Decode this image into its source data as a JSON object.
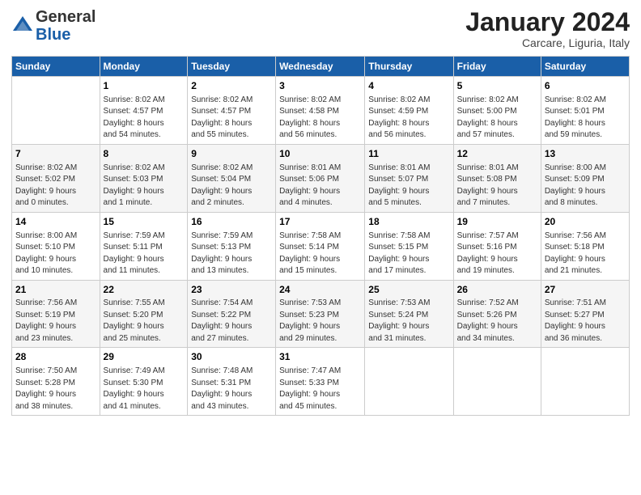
{
  "header": {
    "logo_general": "General",
    "logo_blue": "Blue",
    "month_title": "January 2024",
    "subtitle": "Carcare, Liguria, Italy"
  },
  "columns": [
    "Sunday",
    "Monday",
    "Tuesday",
    "Wednesday",
    "Thursday",
    "Friday",
    "Saturday"
  ],
  "weeks": [
    [
      {
        "day": "",
        "info": ""
      },
      {
        "day": "1",
        "info": "Sunrise: 8:02 AM\nSunset: 4:57 PM\nDaylight: 8 hours\nand 54 minutes."
      },
      {
        "day": "2",
        "info": "Sunrise: 8:02 AM\nSunset: 4:57 PM\nDaylight: 8 hours\nand 55 minutes."
      },
      {
        "day": "3",
        "info": "Sunrise: 8:02 AM\nSunset: 4:58 PM\nDaylight: 8 hours\nand 56 minutes."
      },
      {
        "day": "4",
        "info": "Sunrise: 8:02 AM\nSunset: 4:59 PM\nDaylight: 8 hours\nand 56 minutes."
      },
      {
        "day": "5",
        "info": "Sunrise: 8:02 AM\nSunset: 5:00 PM\nDaylight: 8 hours\nand 57 minutes."
      },
      {
        "day": "6",
        "info": "Sunrise: 8:02 AM\nSunset: 5:01 PM\nDaylight: 8 hours\nand 59 minutes."
      }
    ],
    [
      {
        "day": "7",
        "info": "Sunrise: 8:02 AM\nSunset: 5:02 PM\nDaylight: 9 hours\nand 0 minutes."
      },
      {
        "day": "8",
        "info": "Sunrise: 8:02 AM\nSunset: 5:03 PM\nDaylight: 9 hours\nand 1 minute."
      },
      {
        "day": "9",
        "info": "Sunrise: 8:02 AM\nSunset: 5:04 PM\nDaylight: 9 hours\nand 2 minutes."
      },
      {
        "day": "10",
        "info": "Sunrise: 8:01 AM\nSunset: 5:06 PM\nDaylight: 9 hours\nand 4 minutes."
      },
      {
        "day": "11",
        "info": "Sunrise: 8:01 AM\nSunset: 5:07 PM\nDaylight: 9 hours\nand 5 minutes."
      },
      {
        "day": "12",
        "info": "Sunrise: 8:01 AM\nSunset: 5:08 PM\nDaylight: 9 hours\nand 7 minutes."
      },
      {
        "day": "13",
        "info": "Sunrise: 8:00 AM\nSunset: 5:09 PM\nDaylight: 9 hours\nand 8 minutes."
      }
    ],
    [
      {
        "day": "14",
        "info": "Sunrise: 8:00 AM\nSunset: 5:10 PM\nDaylight: 9 hours\nand 10 minutes."
      },
      {
        "day": "15",
        "info": "Sunrise: 7:59 AM\nSunset: 5:11 PM\nDaylight: 9 hours\nand 11 minutes."
      },
      {
        "day": "16",
        "info": "Sunrise: 7:59 AM\nSunset: 5:13 PM\nDaylight: 9 hours\nand 13 minutes."
      },
      {
        "day": "17",
        "info": "Sunrise: 7:58 AM\nSunset: 5:14 PM\nDaylight: 9 hours\nand 15 minutes."
      },
      {
        "day": "18",
        "info": "Sunrise: 7:58 AM\nSunset: 5:15 PM\nDaylight: 9 hours\nand 17 minutes."
      },
      {
        "day": "19",
        "info": "Sunrise: 7:57 AM\nSunset: 5:16 PM\nDaylight: 9 hours\nand 19 minutes."
      },
      {
        "day": "20",
        "info": "Sunrise: 7:56 AM\nSunset: 5:18 PM\nDaylight: 9 hours\nand 21 minutes."
      }
    ],
    [
      {
        "day": "21",
        "info": "Sunrise: 7:56 AM\nSunset: 5:19 PM\nDaylight: 9 hours\nand 23 minutes."
      },
      {
        "day": "22",
        "info": "Sunrise: 7:55 AM\nSunset: 5:20 PM\nDaylight: 9 hours\nand 25 minutes."
      },
      {
        "day": "23",
        "info": "Sunrise: 7:54 AM\nSunset: 5:22 PM\nDaylight: 9 hours\nand 27 minutes."
      },
      {
        "day": "24",
        "info": "Sunrise: 7:53 AM\nSunset: 5:23 PM\nDaylight: 9 hours\nand 29 minutes."
      },
      {
        "day": "25",
        "info": "Sunrise: 7:53 AM\nSunset: 5:24 PM\nDaylight: 9 hours\nand 31 minutes."
      },
      {
        "day": "26",
        "info": "Sunrise: 7:52 AM\nSunset: 5:26 PM\nDaylight: 9 hours\nand 34 minutes."
      },
      {
        "day": "27",
        "info": "Sunrise: 7:51 AM\nSunset: 5:27 PM\nDaylight: 9 hours\nand 36 minutes."
      }
    ],
    [
      {
        "day": "28",
        "info": "Sunrise: 7:50 AM\nSunset: 5:28 PM\nDaylight: 9 hours\nand 38 minutes."
      },
      {
        "day": "29",
        "info": "Sunrise: 7:49 AM\nSunset: 5:30 PM\nDaylight: 9 hours\nand 41 minutes."
      },
      {
        "day": "30",
        "info": "Sunrise: 7:48 AM\nSunset: 5:31 PM\nDaylight: 9 hours\nand 43 minutes."
      },
      {
        "day": "31",
        "info": "Sunrise: 7:47 AM\nSunset: 5:33 PM\nDaylight: 9 hours\nand 45 minutes."
      },
      {
        "day": "",
        "info": ""
      },
      {
        "day": "",
        "info": ""
      },
      {
        "day": "",
        "info": ""
      }
    ]
  ]
}
